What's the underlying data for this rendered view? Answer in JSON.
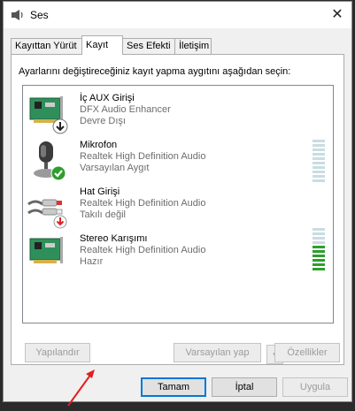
{
  "window": {
    "title": "Ses",
    "close_glyph": "✕"
  },
  "tabs": [
    {
      "label": "Kayıttan Yürüt",
      "active": false
    },
    {
      "label": "Kayıt",
      "active": true
    },
    {
      "label": "Ses Efekti",
      "active": false
    },
    {
      "label": "İletişim",
      "active": false
    }
  ],
  "instruction": "Ayarlarını değiştireceğiniz kayıt yapma aygıtını aşağıdan seçin:",
  "devices": [
    {
      "name": "İç AUX Girişi",
      "driver": "DFX Audio Enhancer",
      "status": "Devre Dışı",
      "icon": "sound-card-icon",
      "badge": "down-arrow-badge"
    },
    {
      "name": "Mikrofon",
      "driver": "Realtek High Definition Audio",
      "status": "Varsayılan Aygıt",
      "icon": "microphone-icon",
      "badge": "default-check-badge",
      "meter_level": 0
    },
    {
      "name": "Hat Girişi",
      "driver": "Realtek High Definition Audio",
      "status": "Takılı değil",
      "icon": "line-in-cable-icon",
      "badge": "unplugged-arrow-badge"
    },
    {
      "name": "Stereo Karışımı",
      "driver": "Realtek High Definition Audio",
      "status": "Hazır",
      "icon": "sound-card-icon",
      "meter_level": 0.6
    }
  ],
  "buttons": {
    "configure": "Yapılandır",
    "set_default": "Varsayılan yap",
    "set_default_dropdown": "▾",
    "properties": "Özellikler",
    "ok": "Tamam",
    "cancel": "İptal",
    "apply": "Uygula"
  },
  "colors": {
    "meter_active": "#2e9e2e",
    "meter_inactive": "#c8dde2",
    "annotation_arrow": "#e02020",
    "focus_border": "#0078d7"
  }
}
